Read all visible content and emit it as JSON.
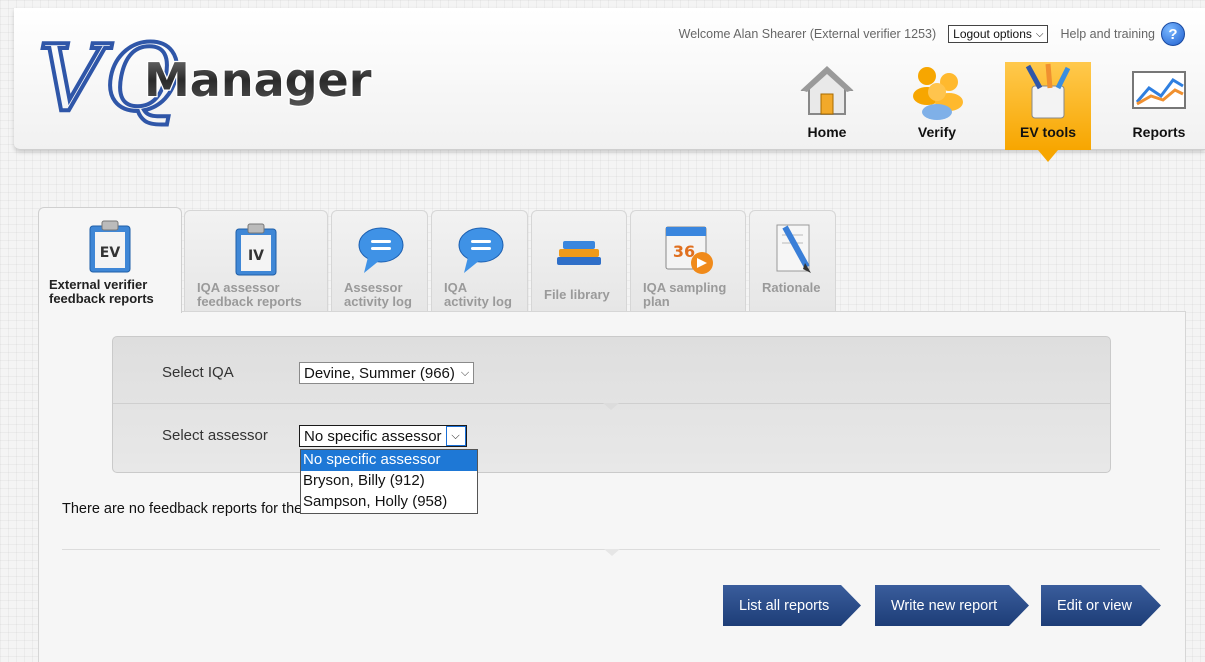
{
  "header": {
    "logo": {
      "part1": "VQ",
      "part2": "Manager"
    },
    "welcome_text": "Welcome Alan Shearer (External verifier 1253)",
    "logout_label": "Logout options",
    "help_label": "Help and training",
    "help_icon": "?"
  },
  "nav": [
    {
      "label": "Home",
      "icon": "house-icon"
    },
    {
      "label": "Verify",
      "icon": "people-icon"
    },
    {
      "label": "EV tools",
      "icon": "tools-cup-icon",
      "active": true
    },
    {
      "label": "Reports",
      "icon": "chart-icon"
    }
  ],
  "tabs": [
    {
      "line1": "External verifier",
      "line2": "feedback reports",
      "icon": "clipboard-ev-icon",
      "badge": "EV",
      "active": true
    },
    {
      "line1": "IQA assessor",
      "line2": "feedback reports",
      "icon": "clipboard-iv-icon",
      "badge": "IV"
    },
    {
      "line1": "Assessor",
      "line2": "activity log",
      "icon": "speech-bubble-icon"
    },
    {
      "line1": "IQA",
      "line2": "activity log",
      "icon": "speech-bubble-icon"
    },
    {
      "line1": "File library",
      "line2": "",
      "icon": "stacked-files-icon"
    },
    {
      "line1": "IQA sampling",
      "line2": "plan",
      "icon": "calendar-arrow-icon",
      "badge": "36"
    },
    {
      "line1": "Rationale",
      "line2": "",
      "icon": "pencil-document-icon"
    }
  ],
  "filters": {
    "iqa_label": "Select IQA",
    "iqa_value": "Devine, Summer (966)",
    "assessor_label": "Select assessor",
    "assessor_value": "No specific assessor",
    "assessor_options": [
      "No specific assessor",
      "Bryson, Billy (912)",
      "Sampson, Holly (958)"
    ]
  },
  "message": "There are no feedback reports for the above selection",
  "actions": {
    "list": "List all reports",
    "write": "Write new report",
    "edit": "Edit or view"
  },
  "colors": {
    "accent": "#f7a600",
    "button": "#1d3d77",
    "selected": "#1e78d6"
  }
}
